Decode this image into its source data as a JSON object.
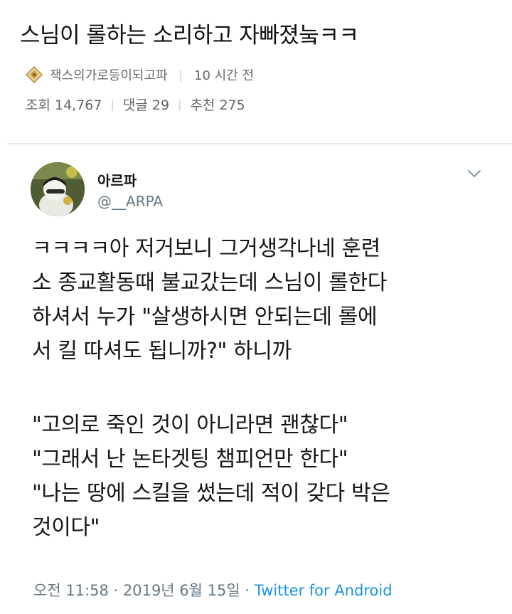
{
  "post": {
    "title": "스님이 롤하는 소리하고 자빠졌눜ㅋㅋ",
    "author": "잭스의가로등이되고파",
    "time_ago": "10 시간 전",
    "views_label": "조회 14,767",
    "comments_label": "댓글 29",
    "recommend_label": "추천 275"
  },
  "tweet": {
    "name": "아르파",
    "handle": "@__ARPA",
    "lines": [
      "ㅋㅋㅋㅋ아 저거보니 그거생각나네 훈련",
      "소 종교활동때 불교갔는데 스님이 롤한다",
      "하셔서 누가 \"살생하시면 안되는데 롤에",
      "서 킬 따셔도 됩니까?\" 하니까",
      "\"고의로 죽인 것이 아니라면 괜찮다\"",
      "\"그래서 난 논타겟팅 챔피언만 한다\"",
      "\"나는 땅에 스킬을 썼는데 적이 갖다 박은",
      "것이다\""
    ],
    "timestamp": "오전 11:58 · 2019년 6월 15일 · ",
    "source": "Twitter for Android"
  },
  "icons": {
    "badge": "diamond-rank-icon",
    "menu": "chevron-down-icon"
  },
  "colors": {
    "meta_gray": "#666666",
    "twitter_gray": "#657786",
    "twitter_blue": "#1b95e0",
    "badge_gold": "#c9a24a"
  }
}
